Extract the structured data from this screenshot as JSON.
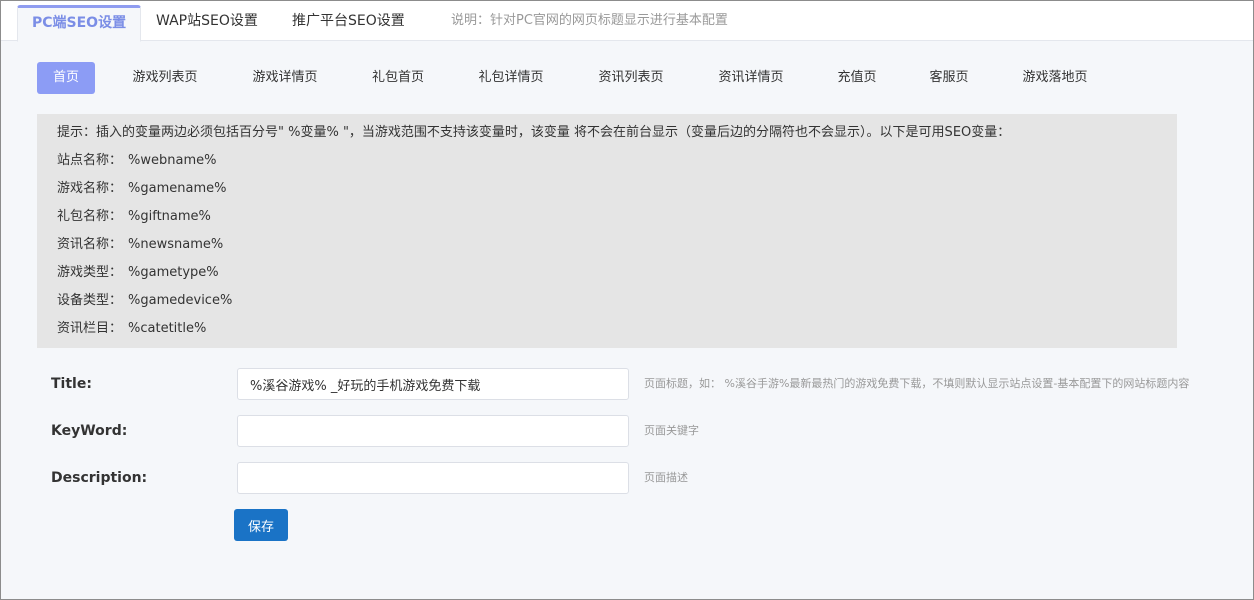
{
  "top_tabs": [
    {
      "label": "PC端SEO设置",
      "active": true
    },
    {
      "label": "WAP站SEO设置",
      "active": false
    },
    {
      "label": "推广平台SEO设置",
      "active": false
    }
  ],
  "top_note": "说明：针对PC官网的网页标题显示进行基本配置",
  "sub_tabs": [
    {
      "label": "首页",
      "active": true
    },
    {
      "label": "游戏列表页",
      "active": false
    },
    {
      "label": "游戏详情页",
      "active": false
    },
    {
      "label": "礼包首页",
      "active": false
    },
    {
      "label": "礼包详情页",
      "active": false
    },
    {
      "label": "资讯列表页",
      "active": false
    },
    {
      "label": "资讯详情页",
      "active": false
    },
    {
      "label": "充值页",
      "active": false
    },
    {
      "label": "客服页",
      "active": false
    },
    {
      "label": "游戏落地页",
      "active": false
    }
  ],
  "hint": {
    "text": "提示：插入的变量两边必须包括百分号\" %变量% \"，当游戏范围不支持该变量时，该变量 将不会在前台显示（变量后边的分隔符也不会显示）。以下是可用SEO变量：",
    "vars": [
      {
        "name": "站点名称：",
        "value": "%webname%"
      },
      {
        "name": "游戏名称：",
        "value": "%gamename%"
      },
      {
        "name": "礼包名称：",
        "value": "%giftname%"
      },
      {
        "name": "资讯名称：",
        "value": "%newsname%"
      },
      {
        "name": "游戏类型：",
        "value": "%gametype%"
      },
      {
        "name": "设备类型：",
        "value": "%gamedevice%"
      },
      {
        "name": "资讯栏目：",
        "value": "%catetitle%"
      }
    ]
  },
  "form": {
    "title_label": "Title:",
    "title_value": "%溪谷游戏% _好玩的手机游戏免费下载",
    "title_help": "页面标题，如： %溪谷手游%最新最热门的游戏免费下载，不填则默认显示站点设置-基本配置下的网站标题内容",
    "keyword_label": "KeyWord:",
    "keyword_value": "",
    "keyword_help": "页面关键字",
    "description_label": "Description:",
    "description_value": "",
    "description_help": "页面描述",
    "save_label": "保存"
  }
}
